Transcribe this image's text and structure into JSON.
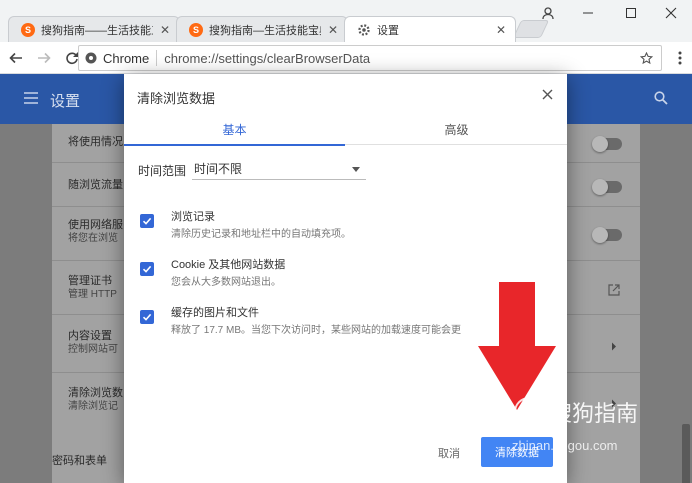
{
  "browser": {
    "tabs": [
      {
        "title": "搜狗指南——生活技能三",
        "favicon": "sogou-s-icon",
        "active": false
      },
      {
        "title": "搜狗指南—生活技能宝典",
        "favicon": "sogou-s-icon",
        "active": false
      },
      {
        "title": "设置",
        "favicon": "gear-icon",
        "active": true
      }
    ],
    "site_label": "Chrome",
    "url": "chrome://settings/clearBrowserData"
  },
  "settings_page": {
    "header_title": "设置",
    "rows": [
      {
        "title": "将使用情况",
        "sub": ""
      },
      {
        "title": "随浏览流量",
        "sub": ""
      },
      {
        "title": "使用网络服",
        "sub": "将您在浏览"
      },
      {
        "title": "管理证书",
        "sub": "管理 HTTP"
      },
      {
        "title": "内容设置",
        "sub": "控制网站可"
      },
      {
        "title": "清除浏览数",
        "sub": "清除浏览记"
      }
    ],
    "section_label": "密码和表单"
  },
  "dialog": {
    "title": "清除浏览数据",
    "tabs": [
      "基本",
      "高级"
    ],
    "active_tab": "基本",
    "time_range_label": "时间范围",
    "time_range_value": "时间不限",
    "options": [
      {
        "title": "浏览记录",
        "sub": "清除历史记录和地址栏中的自动填充项。",
        "checked": true
      },
      {
        "title": "Cookie 及其他网站数据",
        "sub": "您会从大多数网站退出。",
        "checked": true
      },
      {
        "title": "缓存的图片和文件",
        "sub": "释放了 17.7 MB。当您下次访问时，某些网站的加载速度可能会更",
        "checked": true
      }
    ],
    "cancel_label": "取消",
    "clear_label": "清除数据"
  },
  "overlay": {
    "watermark_text": "搜狗指南",
    "watermark_url": "zhinan.sogou.com",
    "arrow_color": "#e8262a"
  },
  "colors": {
    "accent": "#3367d6",
    "button": "#4285f4",
    "header": "#2a57a6"
  }
}
